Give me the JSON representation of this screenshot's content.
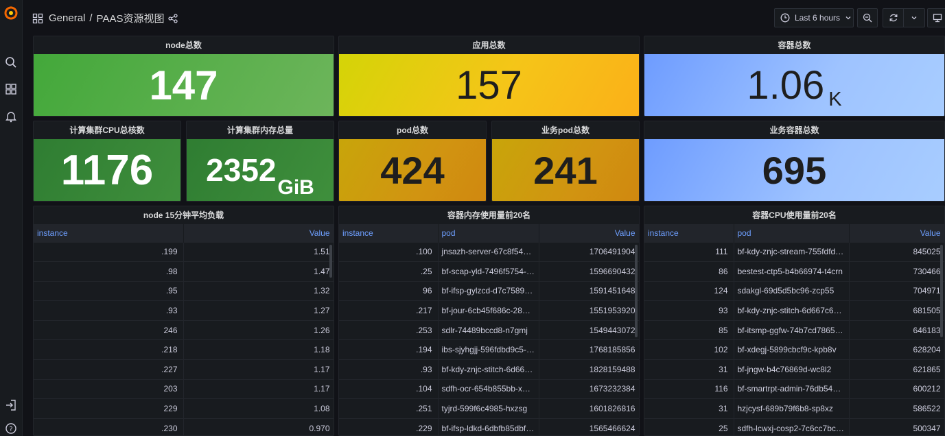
{
  "header": {
    "breadcrumb_root": "General",
    "breadcrumb_sep": "/",
    "breadcrumb_page": "PAAS资源视图",
    "time_range": "Last 6 hours"
  },
  "stats": [
    {
      "title": "node总数",
      "value": "147",
      "unit": ""
    },
    {
      "title": "应用总数",
      "value": "157",
      "unit": ""
    },
    {
      "title": "容器总数",
      "value": "1.06",
      "unit": "K"
    },
    {
      "title": "计算集群CPU总核数",
      "value": "1176",
      "unit": ""
    },
    {
      "title": "计算集群内存总量",
      "value": "2352",
      "unit": "GiB"
    },
    {
      "title": "pod总数",
      "value": "424",
      "unit": ""
    },
    {
      "title": "业务pod总数",
      "value": "241",
      "unit": ""
    },
    {
      "title": "业务容器总数",
      "value": "695",
      "unit": ""
    }
  ],
  "colors": {
    "green": "#56a64b",
    "yellow": "#f2cc0c",
    "blue": "#8ab8ff"
  },
  "table1": {
    "title": "node 15分钟平均负载",
    "columns": [
      "instance",
      "Value"
    ],
    "rows": [
      [
        ".199",
        "1.51"
      ],
      [
        ".98",
        "1.47"
      ],
      [
        ".95",
        "1.32"
      ],
      [
        ".93",
        "1.27"
      ],
      [
        "246",
        "1.26"
      ],
      [
        ".218",
        "1.18"
      ],
      [
        ".227",
        "1.17"
      ],
      [
        "203",
        "1.17"
      ],
      [
        "229",
        "1.08"
      ],
      [
        ".230",
        "0.970"
      ]
    ]
  },
  "table2": {
    "title": "容器内存使用量前20名",
    "columns": [
      "instance",
      "pod",
      "Value"
    ],
    "rows": [
      [
        ".100",
        "jnsazh-server-67c8f548…",
        "1706491904"
      ],
      [
        ".25",
        "bf-scap-yld-7496f5754-8…",
        "1596690432"
      ],
      [
        "96",
        "bf-ifsp-gylzcd-d7c75894…",
        "1591451648"
      ],
      [
        ".217",
        "bf-jour-6cb45f686c-28g…",
        "1551953920"
      ],
      [
        ".253",
        "sdlr-74489bccd8-n7gmj",
        "1549443072"
      ],
      [
        ".194",
        "ibs-sjyhgjj-596fdbd9c5-6…",
        "1768185856"
      ],
      [
        ".93",
        "bf-kdy-znjc-stitch-6d667…",
        "1828159488"
      ],
      [
        ".104",
        "sdfh-ocr-654b855bb-xd6…",
        "1673232384"
      ],
      [
        ".251",
        "tyjrd-599f6c4985-hxzsg",
        "1601826816"
      ],
      [
        ".229",
        "bf-ifsp-ldkd-6dbfb85dbf-…",
        "1565466624"
      ]
    ]
  },
  "table3": {
    "title": "容器CPU使用量前20名",
    "columns": [
      "instance",
      "pod",
      "Value"
    ],
    "rows": [
      [
        "111",
        "bf-kdy-znjc-stream-755fdfd9…",
        "845025"
      ],
      [
        "86",
        "bestest-ctp5-b4b66974-t4crn",
        "730466"
      ],
      [
        "124",
        "sdakgl-69d5d5bc96-zcp55",
        "704971"
      ],
      [
        "93",
        "bf-kdy-znjc-stitch-6d667c6b-…",
        "681505"
      ],
      [
        "85",
        "bf-itsmp-ggfw-74b7cd7865-…",
        "646183"
      ],
      [
        "102",
        "bf-xdegj-5899cbcf9c-kpb8v",
        "628204"
      ],
      [
        "31",
        "bf-jngw-b4c76869d-wc8l2",
        "621865"
      ],
      [
        "116",
        "bf-smartrpt-admin-76db54b…",
        "600212"
      ],
      [
        "31",
        "hzjcysf-689b79f6b8-sp8xz",
        "586522"
      ],
      [
        "25",
        "sdfh-lcwxj-cosp2-7c6cc7bc…",
        "500347"
      ]
    ]
  }
}
